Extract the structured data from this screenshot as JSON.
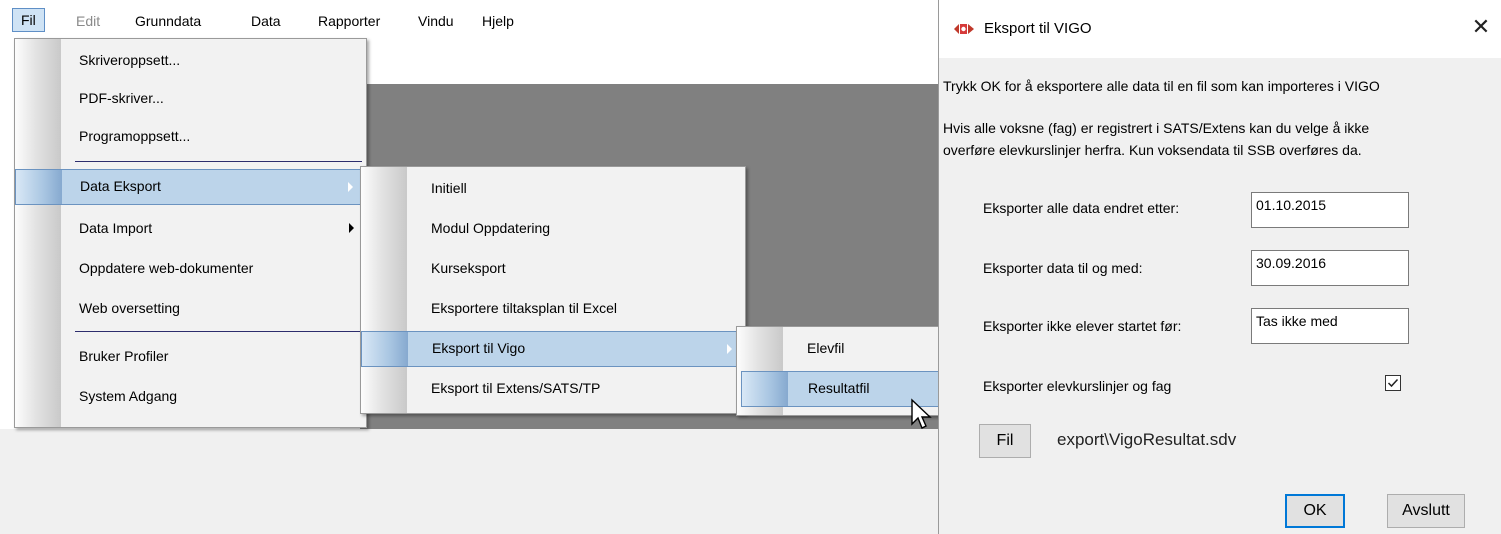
{
  "menubar": {
    "items": [
      {
        "label": "Fil"
      },
      {
        "label": "Edit"
      },
      {
        "label": "Grunndata"
      },
      {
        "label": "Data"
      },
      {
        "label": "Rapporter"
      },
      {
        "label": "Vindu"
      },
      {
        "label": "Hjelp"
      }
    ]
  },
  "fil_menu": {
    "items": [
      "Skriveroppsett...",
      "PDF-skriver...",
      "Programoppsett...",
      "Data Eksport",
      "Data Import",
      "Oppdatere web-dokumenter",
      "Web oversetting",
      "Bruker Profiler",
      "System Adgang"
    ]
  },
  "eksport_menu": {
    "items": [
      "Initiell",
      "Modul Oppdatering",
      "Kurseksport",
      "Eksportere tiltaksplan til Excel",
      "Eksport til Vigo",
      "Eksport til Extens/SATS/TP"
    ]
  },
  "vigo_menu": {
    "items": [
      "Elevfil",
      "Resultatfil"
    ]
  },
  "dialog": {
    "title": "Eksport til VIGO",
    "intro": "Trykk OK for å eksportere alle data til en fil som kan importeres i VIGO",
    "info_line1": "Hvis alle voksne (fag) er registrert i SATS/Extens kan du velge å ikke",
    "info_line2": "overføre elevkurslinjer herfra. Kun voksendata til SSB overføres da.",
    "fields": {
      "changed_after_label": "Eksporter alle data endret etter:",
      "changed_after_value": "01.10.2015",
      "until_label": "Eksporter data til og med:",
      "until_value": "30.09.2016",
      "not_started_label": "Eksporter ikke elever startet før:",
      "not_started_value": "Tas ikke med",
      "courses_label": "Eksporter elevkurslinjer og fag",
      "courses_checked": true
    },
    "file_button": "Fil",
    "file_path": "export\\VigoResultat.sdv",
    "ok_button": "OK",
    "exit_button": "Avslutt"
  },
  "colors": {
    "menu_highlight": "#bcd4ea",
    "focus_blue": "#0078d7"
  }
}
